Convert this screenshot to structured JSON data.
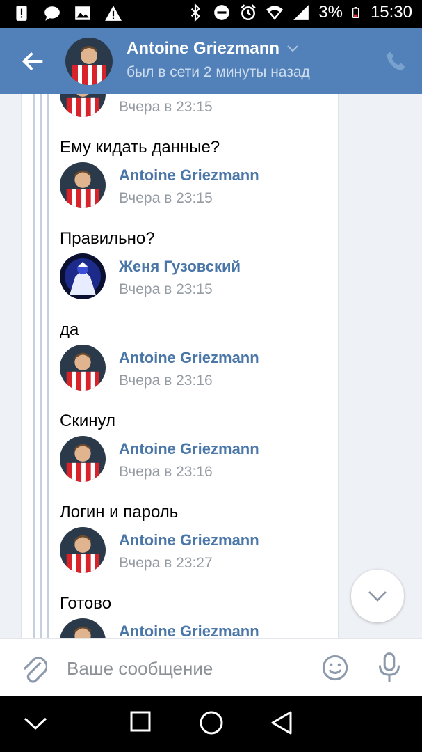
{
  "status_bar": {
    "battery_percent": "3%",
    "time": "15:30",
    "icons": [
      "alert-icon",
      "message-icon",
      "image-icon",
      "warning-icon",
      "bluetooth-icon",
      "dnd-icon",
      "alarm-icon",
      "wifi-icon",
      "signal-icon",
      "battery-low-icon"
    ]
  },
  "header": {
    "contact_name": "Antoine Griezmann",
    "last_seen": "был в сети 2 минуты назад"
  },
  "messages": [
    {
      "name": "",
      "time": "Вчера в 23:15",
      "text": "Ему кидать данные?",
      "avatar": "griezmann"
    },
    {
      "name": "Antoine Griezmann",
      "time": "Вчера в 23:15",
      "text": "Правильно?",
      "avatar": "griezmann"
    },
    {
      "name": "Женя Гузовский",
      "time": "Вчера в 23:15",
      "text": "да",
      "avatar": "zhenya"
    },
    {
      "name": "Antoine Griezmann",
      "time": "Вчера в 23:16",
      "text": "Скинул",
      "avatar": "griezmann"
    },
    {
      "name": "Antoine Griezmann",
      "time": "Вчера в 23:16",
      "text": "Логин и пароль",
      "avatar": "griezmann"
    },
    {
      "name": "Antoine Griezmann",
      "time": "Вчера в 23:27",
      "text": "Готово",
      "avatar": "griezmann"
    },
    {
      "name": "Antoine Griezmann",
      "time": "",
      "text": "",
      "avatar": "griezmann"
    }
  ],
  "composer": {
    "placeholder": "Ваше сообщение"
  },
  "colors": {
    "header_bg": "#5181b8",
    "accent_name": "#4a76a8",
    "time_gray": "#959ba3"
  }
}
